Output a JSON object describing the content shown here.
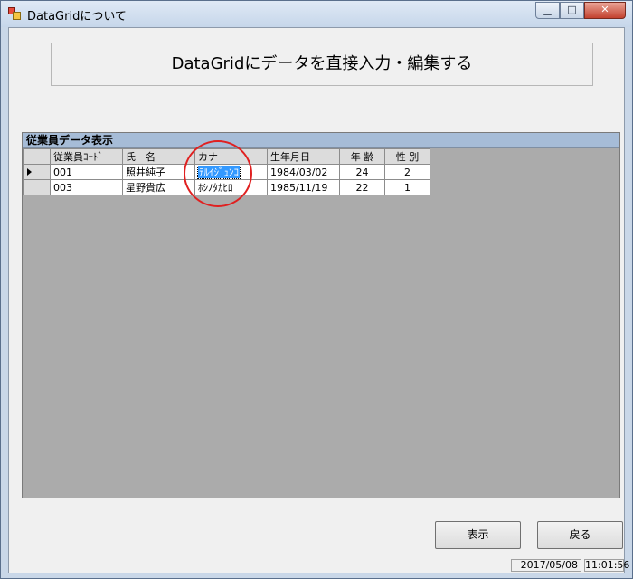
{
  "window": {
    "title": "DataGridについて"
  },
  "heading": "DataGridにデータを直接入力・編集する",
  "grid": {
    "caption": "従業員データ表示",
    "columns": [
      "従業員ｺｰﾄﾞ",
      "氏　名",
      "カナ",
      "生年月日",
      "年 齢",
      "性 別"
    ],
    "rows": [
      {
        "code": "001",
        "name": "照井純子",
        "kana": "ﾃﾙｲｼﾞｭﾝｺ",
        "birth": "1984/03/02",
        "age": "24",
        "sex": "2"
      },
      {
        "code": "003",
        "name": "星野貴広",
        "kana": "ﾎｼﾉﾀｶﾋﾛ",
        "birth": "1985/11/19",
        "age": "22",
        "sex": "1"
      }
    ]
  },
  "buttons": {
    "show": "表示",
    "back": "戻る"
  },
  "status": {
    "date": "2017/05/08",
    "time": "11:01:56"
  },
  "colors": {
    "caption_bg": "#a6bcd7",
    "grid_bg": "#ababab",
    "selection": "#3399ff",
    "highlight_circle": "#e02020"
  }
}
